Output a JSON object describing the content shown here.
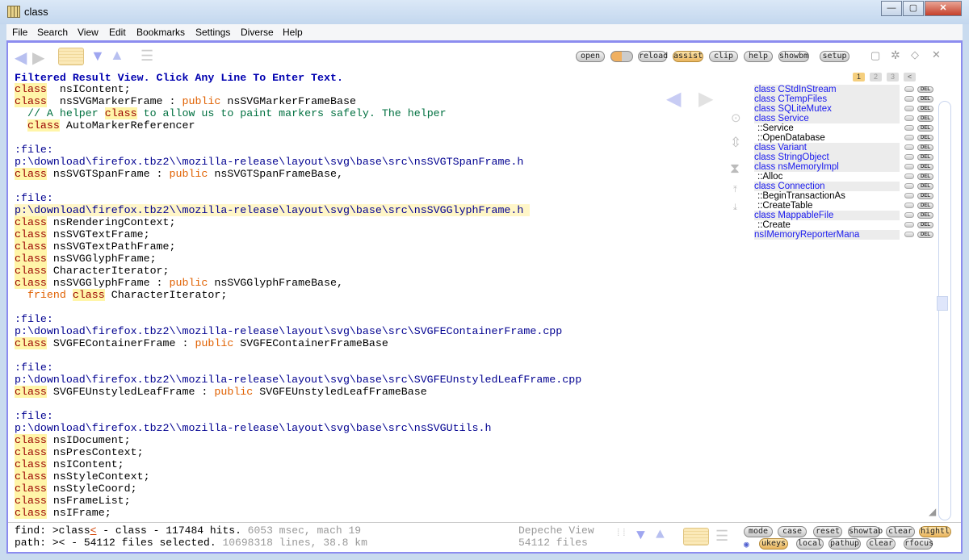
{
  "window": {
    "title": "class",
    "min": "—",
    "max": "▢",
    "close": "✕"
  },
  "menu": [
    "File",
    "Search",
    "View",
    "Edit",
    "Bookmarks",
    "Settings",
    "Diverse",
    "Help"
  ],
  "toolbar": {
    "buttons": [
      "open",
      "reload",
      "assist",
      "clip",
      "help",
      "showbm",
      "setup"
    ],
    "active": "assist"
  },
  "header": "Filtered Result View. Click Any Line To Enter Text.",
  "page_tabs": [
    "1",
    "2",
    "3"
  ],
  "code_lines": [
    [
      [
        "kw",
        "class"
      ],
      [
        "",
        "  nsIContent;"
      ]
    ],
    [
      [
        "kw",
        "class"
      ],
      [
        "",
        "  nsSVGMarkerFrame : "
      ],
      [
        "pub",
        "public"
      ],
      [
        "",
        " nsSVGMarkerFrameBase"
      ]
    ],
    [
      [
        "cm",
        "  // A helper "
      ],
      [
        "kw",
        "class"
      ],
      [
        "cm",
        " to allow us to paint markers safely. The helper"
      ]
    ],
    [
      [
        "",
        "  "
      ],
      [
        "kw",
        "class"
      ],
      [
        "",
        " AutoMarkerReferencer"
      ]
    ],
    [],
    [
      [
        "path",
        ":file:"
      ]
    ],
    [
      [
        "path",
        "p:\\download\\firefox.tbz2\\\\mozilla-release\\layout\\svg\\base\\src\\nsSVGTSpanFrame.h"
      ]
    ],
    [
      [
        "kw",
        "class"
      ],
      [
        "",
        " nsSVGTSpanFrame : "
      ],
      [
        "pub",
        "public"
      ],
      [
        "",
        " nsSVGTSpanFrameBase,"
      ]
    ],
    [],
    [
      [
        "path",
        ":file:"
      ]
    ],
    [
      [
        "path",
        "p:\\download\\firefox.tbz2\\\\mozilla-release\\layout\\svg\\base\\src\\nsSVGGlyphFrame.h"
      ]
    ],
    [
      [
        "kw",
        "class"
      ],
      [
        "",
        " nsRenderingContext;"
      ]
    ],
    [
      [
        "kw",
        "class"
      ],
      [
        "",
        " nsSVGTextFrame;"
      ]
    ],
    [
      [
        "kw",
        "class"
      ],
      [
        "",
        " nsSVGTextPathFrame;"
      ]
    ],
    [
      [
        "kw",
        "class"
      ],
      [
        "",
        " nsSVGGlyphFrame;"
      ]
    ],
    [
      [
        "kw",
        "class"
      ],
      [
        "",
        " CharacterIterator;"
      ]
    ],
    [
      [
        "kw",
        "class"
      ],
      [
        "",
        " nsSVGGlyphFrame : "
      ],
      [
        "pub",
        "public"
      ],
      [
        "",
        " nsSVGGlyphFrameBase,"
      ]
    ],
    [
      [
        "",
        "  "
      ],
      [
        "pub",
        "friend"
      ],
      [
        "",
        " "
      ],
      [
        "kw",
        "class"
      ],
      [
        "",
        " CharacterIterator;"
      ]
    ],
    [],
    [
      [
        "path",
        ":file:"
      ]
    ],
    [
      [
        "path",
        "p:\\download\\firefox.tbz2\\\\mozilla-release\\layout\\svg\\base\\src\\SVGFEContainerFrame.cpp"
      ]
    ],
    [
      [
        "kw",
        "class"
      ],
      [
        "",
        " SVGFEContainerFrame : "
      ],
      [
        "pub",
        "public"
      ],
      [
        "",
        " SVGFEContainerFrameBase"
      ]
    ],
    [],
    [
      [
        "path",
        ":file:"
      ]
    ],
    [
      [
        "path",
        "p:\\download\\firefox.tbz2\\\\mozilla-release\\layout\\svg\\base\\src\\SVGFEUnstyledLeafFrame.cpp"
      ]
    ],
    [
      [
        "kw",
        "class"
      ],
      [
        "",
        " SVGFEUnstyledLeafFrame : "
      ],
      [
        "pub",
        "public"
      ],
      [
        "",
        " SVGFEUnstyledLeafFrameBase"
      ]
    ],
    [],
    [
      [
        "path",
        ":file:"
      ]
    ],
    [
      [
        "path",
        "p:\\download\\firefox.tbz2\\\\mozilla-release\\layout\\svg\\base\\src\\nsSVGUtils.h"
      ]
    ],
    [
      [
        "kw",
        "class"
      ],
      [
        "",
        " nsIDocument;"
      ]
    ],
    [
      [
        "kw",
        "class"
      ],
      [
        "",
        " nsPresContext;"
      ]
    ],
    [
      [
        "kw",
        "class"
      ],
      [
        "",
        " nsIContent;"
      ]
    ],
    [
      [
        "kw",
        "class"
      ],
      [
        "",
        " nsStyleContext;"
      ]
    ],
    [
      [
        "kw",
        "class"
      ],
      [
        "",
        " nsStyleCoord;"
      ]
    ],
    [
      [
        "kw",
        "class"
      ],
      [
        "",
        " nsFrameList;"
      ]
    ],
    [
      [
        "kw",
        "class"
      ],
      [
        "",
        " nsIFrame;"
      ]
    ]
  ],
  "outline": [
    {
      "t": "cls",
      "text": "class CStdInStream"
    },
    {
      "t": "cls",
      "text": "class CTempFiles"
    },
    {
      "t": "cls",
      "text": "class SQLiteMutex"
    },
    {
      "t": "cls",
      "text": "class Service"
    },
    {
      "t": "mem",
      "text": "::Service"
    },
    {
      "t": "mem",
      "text": "::OpenDatabase"
    },
    {
      "t": "cls",
      "text": "class Variant"
    },
    {
      "t": "cls",
      "text": "class StringObject"
    },
    {
      "t": "cls",
      "text": "class nsMemoryImpl"
    },
    {
      "t": "mem",
      "text": "::Alloc"
    },
    {
      "t": "cls",
      "text": "class Connection"
    },
    {
      "t": "mem",
      "text": "::BeginTransactionAs"
    },
    {
      "t": "mem",
      "text": "::CreateTable"
    },
    {
      "t": "cls",
      "text": "class MappableFile"
    },
    {
      "t": "mem",
      "text": "::Create"
    },
    {
      "t": "cls",
      "text": "nsIMemoryReporterMana"
    }
  ],
  "del_label": "DEL",
  "status": {
    "find_label": "find: ",
    "find_query": ">class",
    "find_cursor": "<",
    "find_rest": " - class - 117484 hits.",
    "find_meta": " 6053 msec, mach 19",
    "path_label": "path: ",
    "path_query": "><",
    "path_rest": " - 54112 files selected.",
    "path_meta": " 10698318 lines, 38.8 km",
    "view_name": "Depeche View",
    "view_files": "54112 files",
    "buttons_row1": [
      "mode",
      "case",
      "reset",
      "showtab",
      "clear",
      "hightl"
    ],
    "buttons_row2": [
      "ukeys",
      "local",
      "pathup",
      "clear",
      "rfocus"
    ]
  }
}
